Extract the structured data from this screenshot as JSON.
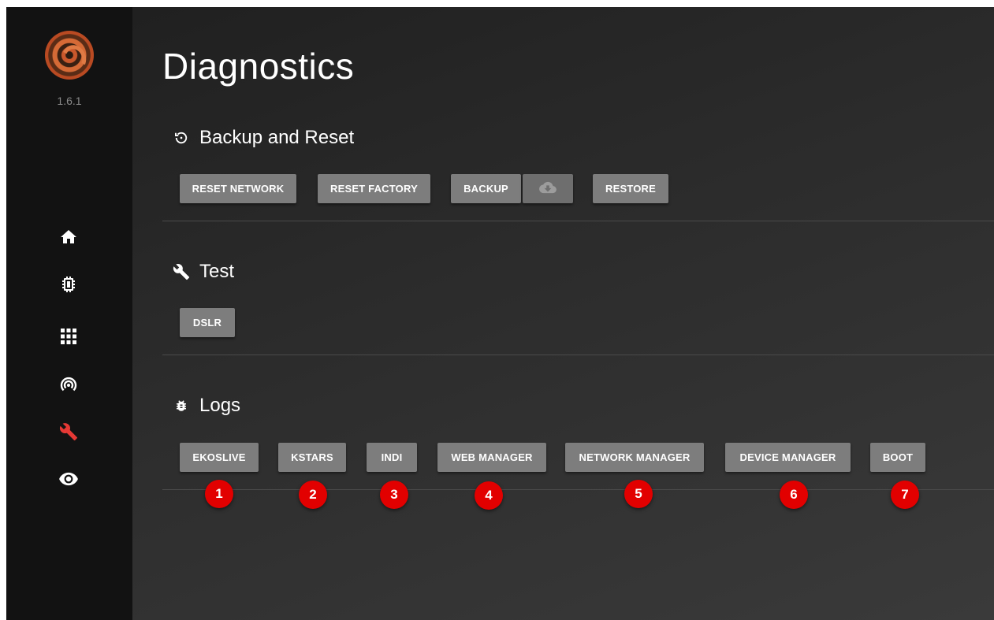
{
  "app": {
    "version": "1.6.1"
  },
  "sidebar": {
    "items": [
      {
        "icon": "home-icon",
        "active": false
      },
      {
        "icon": "chip-icon",
        "active": false
      },
      {
        "icon": "apps-grid-icon",
        "active": false
      },
      {
        "icon": "broadcast-icon",
        "active": false
      },
      {
        "icon": "wrench-icon",
        "active": true
      },
      {
        "icon": "eye-icon",
        "active": false
      }
    ],
    "active_color": "#e53935"
  },
  "page": {
    "title": "Diagnostics"
  },
  "sections": {
    "backup": {
      "icon": "restore-icon",
      "title": "Backup and Reset",
      "buttons": {
        "reset_network": "RESET NETWORK",
        "reset_factory": "RESET FACTORY",
        "backup": "BACKUP",
        "restore": "RESTORE"
      },
      "cloud_icon": "cloud-download-icon"
    },
    "test": {
      "icon": "wrench-icon",
      "title": "Test",
      "buttons": {
        "dslr": "DSLR"
      }
    },
    "logs": {
      "icon": "bug-icon",
      "title": "Logs",
      "buttons": {
        "ekoslive": "EKOSLIVE",
        "kstars": "KSTARS",
        "indi": "INDI",
        "web_manager": "WEB MANAGER",
        "network_manager": "NETWORK MANAGER",
        "device_manager": "DEVICE MANAGER",
        "boot": "BOOT"
      }
    }
  },
  "badges": [
    "1",
    "2",
    "3",
    "4",
    "5",
    "6",
    "7"
  ],
  "colors": {
    "badge": "#e20000",
    "button": "#7d7d7d",
    "sidebar": "#121212"
  }
}
